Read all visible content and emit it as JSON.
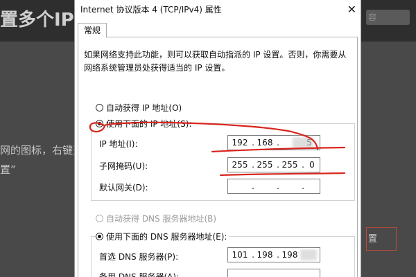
{
  "background": {
    "title_fragment": "置多个IP地",
    "search_fragment": "容",
    "text_line1": "网的图标，右键选",
    "text_line2": "置”",
    "button_fragment": "置"
  },
  "dialog": {
    "title": "Internet 协议版本 4 (TCP/IPv4) 属性",
    "close_symbol": "✕",
    "tab": "常规",
    "description": "如果网络支持此功能，则可以获取自动指派的 IP 设置。否则，你需要从网络系统管理员处获得适当的 IP 设置。",
    "auto_ip_label": "自动获得 IP 地址(O)",
    "manual_ip_label": "使用下面的 IP 地址(S):",
    "ip_label": "IP 地址(I):",
    "subnet_label": "子网掩码(U):",
    "gateway_label": "默认网关(D):",
    "ip_address": [
      "192",
      "168",
      "",
      "5"
    ],
    "subnet_mask": [
      "255",
      "255",
      "255",
      "0"
    ],
    "gateway": [
      "",
      "",
      "",
      ""
    ],
    "auto_dns_label": "自动获得 DNS 服务器地址(B)",
    "manual_dns_label": "使用下面的 DNS 服务器地址(E):",
    "preferred_dns_label": "首选 DNS 服务器(P):",
    "alternate_dns_label": "备用 DNS 服务器(A):",
    "preferred_dns": [
      "101",
      "198",
      "198",
      ""
    ],
    "alternate_dns": [
      "",
      "",
      "",
      ""
    ],
    "selected_ip_mode": "manual",
    "selected_dns_mode": "manual"
  },
  "colors": {
    "annotation_red": "#d8261f",
    "dialog_bg": "#ffffff",
    "page_dim": "#494949"
  }
}
